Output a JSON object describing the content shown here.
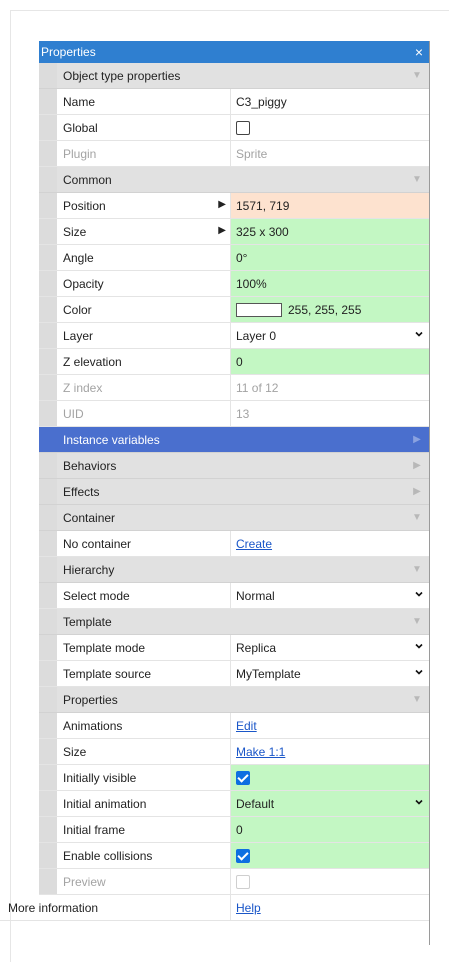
{
  "panel": {
    "title": "Properties",
    "close_glyph": "×"
  },
  "sections": {
    "object_type": "Object type properties",
    "common": "Common",
    "instance_variables": "Instance variables",
    "behaviors": "Behaviors",
    "effects": "Effects",
    "container": "Container",
    "hierarchy": "Hierarchy",
    "template": "Template",
    "properties": "Properties"
  },
  "object_type": {
    "name_label": "Name",
    "name_value": "C3_piggy",
    "global_label": "Global",
    "global_checked": false,
    "plugin_label": "Plugin",
    "plugin_value": "Sprite"
  },
  "common": {
    "position_label": "Position",
    "position_value": "1571, 719",
    "size_label": "Size",
    "size_value": "325 x 300",
    "angle_label": "Angle",
    "angle_value": "0°",
    "opacity_label": "Opacity",
    "opacity_value": "100%",
    "color_label": "Color",
    "color_value": "255, 255, 255",
    "color_swatch": "#ffffff",
    "layer_label": "Layer",
    "layer_value": "Layer 0",
    "zelev_label": "Z elevation",
    "zelev_value": "0",
    "zindex_label": "Z index",
    "zindex_value": "11 of 12",
    "uid_label": "UID",
    "uid_value": "13"
  },
  "container": {
    "label": "No container",
    "link": "Create"
  },
  "hierarchy": {
    "select_label": "Select mode",
    "select_value": "Normal"
  },
  "template": {
    "mode_label": "Template mode",
    "mode_value": "Replica",
    "source_label": "Template source",
    "source_value": "MyTemplate"
  },
  "properties": {
    "anim_label": "Animations",
    "anim_link": "Edit",
    "size_label": "Size",
    "size_link": "Make 1:1",
    "visible_label": "Initially visible",
    "visible_checked": true,
    "initanim_label": "Initial animation",
    "initanim_value": "Default",
    "frame_label": "Initial frame",
    "frame_value": "0",
    "collisions_label": "Enable collisions",
    "collisions_checked": true,
    "preview_label": "Preview"
  },
  "footer": {
    "label": "More information",
    "link": "Help"
  },
  "colors": {
    "titlebar": "#2f7fd0",
    "selected_section": "#4a6fce",
    "changed_green": "#c3f7c3",
    "changed_orange": "#fde2cf",
    "link": "#1a56c8",
    "checkbox_checked": "#0e6fe1"
  }
}
